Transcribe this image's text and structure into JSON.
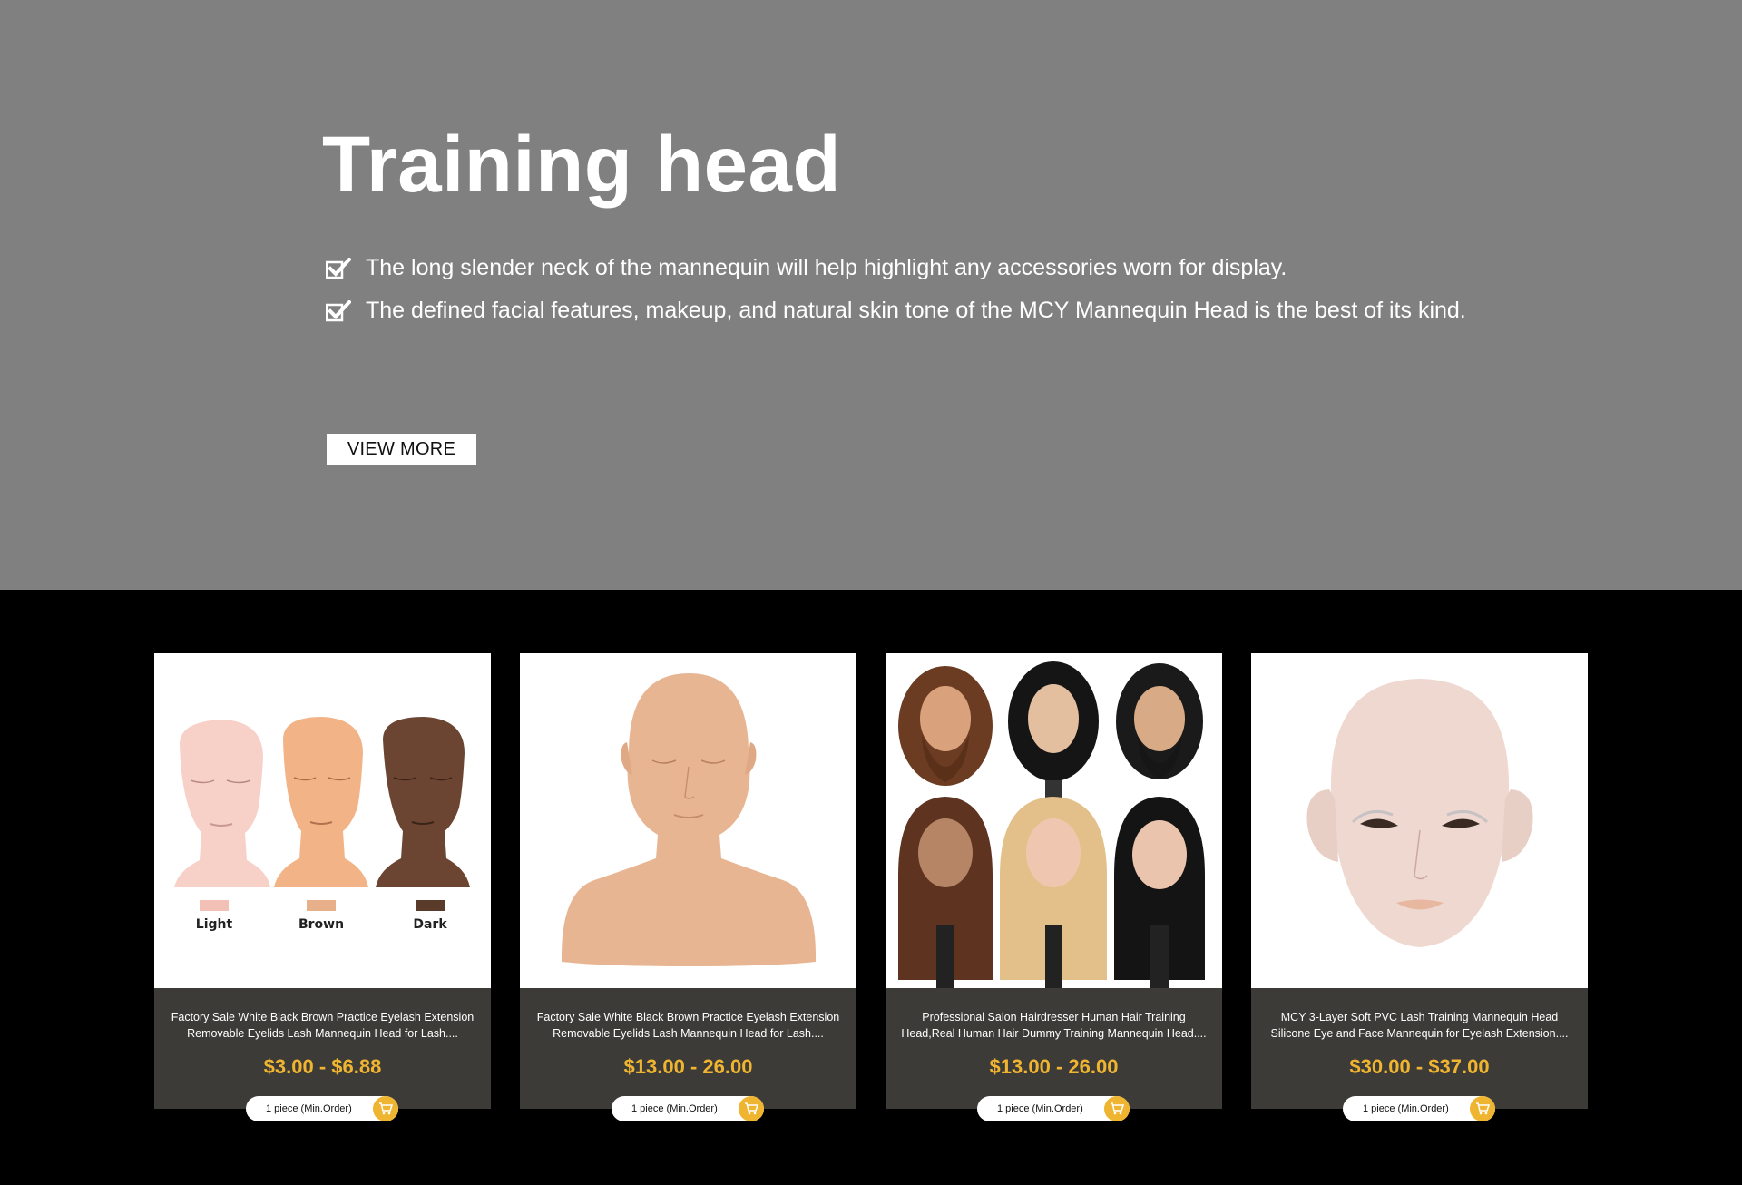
{
  "hero": {
    "title": "Training head",
    "features": [
      "The long slender neck of the mannequin will help highlight any accessories worn for display.",
      "The defined facial features, makeup, and natural skin tone of the MCY Mannequin Head is the best of its kind."
    ],
    "button_label": "VIEW MORE",
    "colors": {
      "background": "#808080",
      "text": "#ffffff"
    }
  },
  "products": [
    {
      "name": "Factory Sale White Black Brown Practice Eyelash Extension Removable Eyelids Lash Mannequin Head for Lash....",
      "price": "$3.00 - $6.88",
      "min_order": "1 piece (Min.Order)",
      "swatch_labels": [
        "Light",
        "Brown",
        "Dark"
      ]
    },
    {
      "name": "Factory Sale White Black Brown Practice Eyelash Extension Removable Eyelids Lash Mannequin Head for Lash....",
      "price": "$13.00 - 26.00",
      "min_order": "1 piece (Min.Order)"
    },
    {
      "name": "Professional Salon Hairdresser Human Hair Training Head,Real Human Hair Dummy Training Mannequin Head....",
      "price": "$13.00 - 26.00",
      "min_order": "1 piece (Min.Order)"
    },
    {
      "name": "MCY 3-Layer Soft PVC Lash Training Mannequin Head Silicone Eye and Face Mannequin for Eyelash Extension....",
      "price": "$30.00 - $37.00",
      "min_order": "1 piece (Min.Order)"
    }
  ],
  "colors": {
    "price": "#f0b530",
    "card_info_bg": "#3d3b37",
    "section_bg": "#000000"
  },
  "icons": {
    "feature": "checkbox-check-icon",
    "cart": "cart-icon"
  }
}
